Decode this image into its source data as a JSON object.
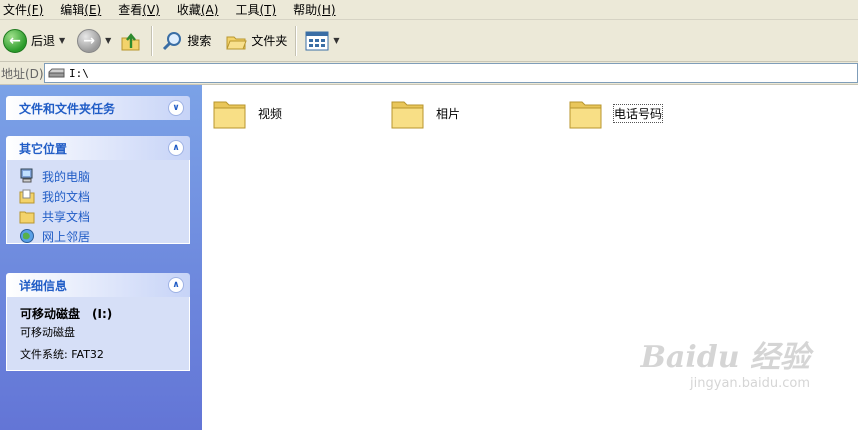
{
  "menubar": {
    "items": [
      {
        "label": "文件",
        "accel": "(F)"
      },
      {
        "label": "编辑",
        "accel": "(E)"
      },
      {
        "label": "查看",
        "accel": "(V)"
      },
      {
        "label": "收藏",
        "accel": "(A)"
      },
      {
        "label": "工具",
        "accel": "(T)"
      },
      {
        "label": "帮助",
        "accel": "(H)"
      }
    ]
  },
  "toolbar": {
    "back_label": "后退",
    "search_label": "搜索",
    "folders_label": "文件夹"
  },
  "address": {
    "label": "地址(D)",
    "value": "I:\\"
  },
  "taskpane": {
    "tasks_title": "文件和文件夹任务",
    "places_title": "其它位置",
    "places": [
      {
        "label": "我的电脑",
        "icon": "my-computer-icon"
      },
      {
        "label": "我的文档",
        "icon": "my-documents-icon"
      },
      {
        "label": "共享文档",
        "icon": "shared-documents-icon"
      },
      {
        "label": "网上邻居",
        "icon": "network-places-icon"
      }
    ],
    "details_title": "详细信息",
    "details": {
      "name": "可移动磁盘　(I:)",
      "type": "可移动磁盘",
      "filesystem": "文件系统: FAT32"
    }
  },
  "files": [
    {
      "name": "视频",
      "icon": "folder-icon"
    },
    {
      "name": "相片",
      "icon": "folder-icon"
    },
    {
      "name": "电话号码",
      "icon": "folder-icon"
    }
  ],
  "watermark": {
    "logo": "Baidu 经验",
    "url": "jingyan.baidu.com"
  }
}
